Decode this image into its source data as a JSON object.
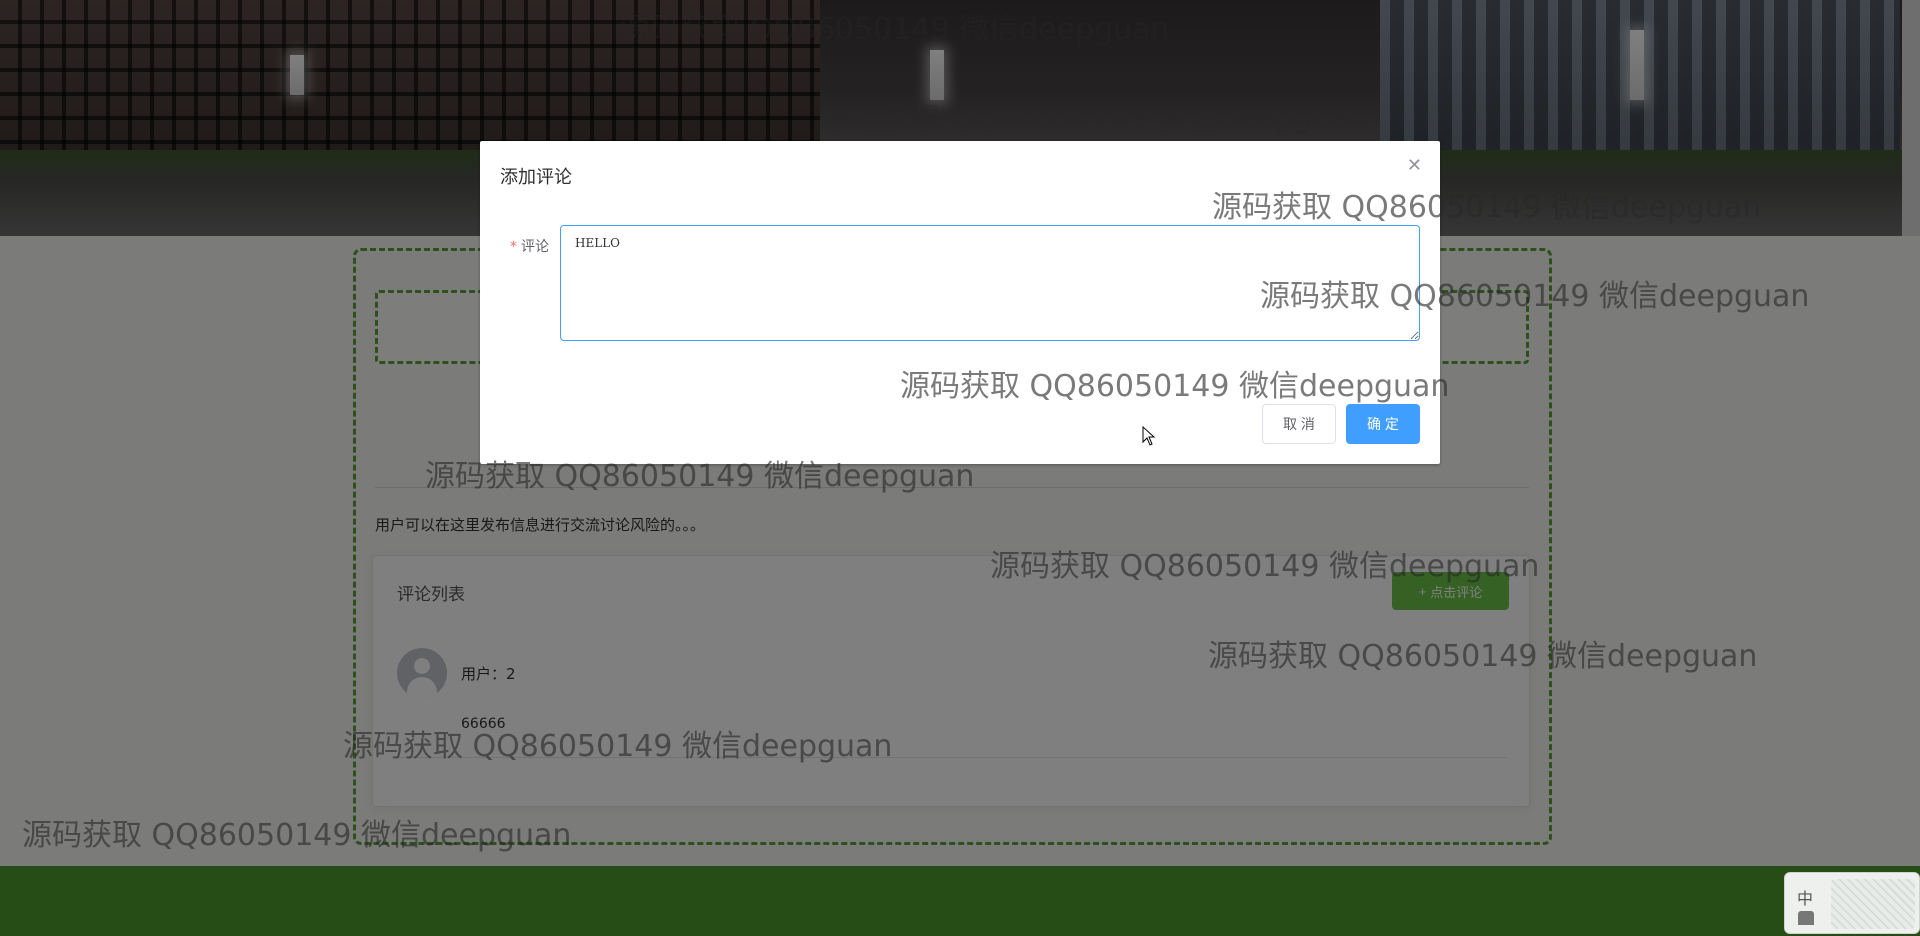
{
  "page": {
    "description": "用户可以在这里发布信息进行交流讨论风险的。。。",
    "comment_panel": {
      "title": "评论列表",
      "add_button_icon": "plus-icon",
      "add_button_label": "点击评论",
      "comments": [
        {
          "user": "用户：2",
          "text": "66666"
        }
      ]
    }
  },
  "dialog": {
    "title": "添加评论",
    "close_icon": "close-icon",
    "field_required_mark": "*",
    "field_label": "评论",
    "field_value": "HELLO",
    "cancel_label": "取 消",
    "confirm_label": "确 定"
  },
  "ime": {
    "lang": "中"
  },
  "watermark": {
    "text": "源码获取 QQ86050149 微信deepguan"
  },
  "colors": {
    "primary": "#409eff",
    "green_accent": "#6cc24a",
    "footer_green": "#4f9a2c",
    "required": "#f56c6c"
  }
}
